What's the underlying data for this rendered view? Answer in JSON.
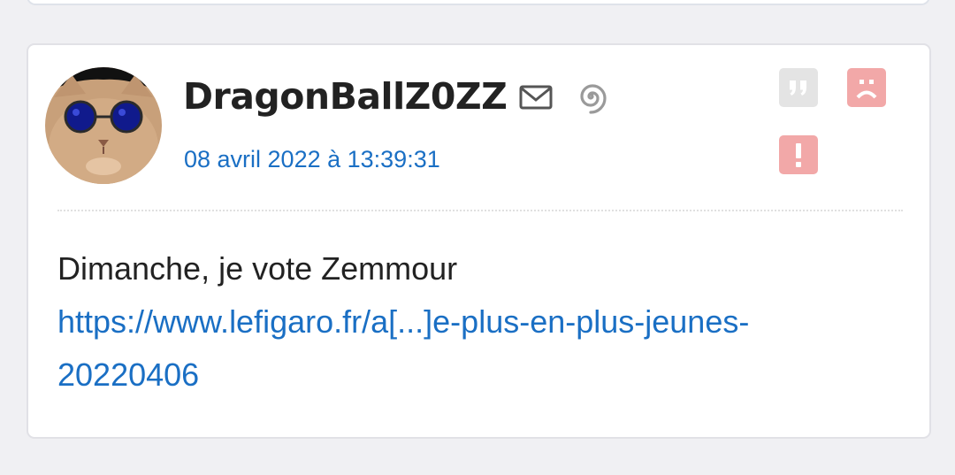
{
  "post": {
    "username": "DragonBallZ0ZZ",
    "date": "08 avril 2022 à 13:39:31",
    "message_text": "Dimanche, je vote Zemmour",
    "link_line1": "https://www.lefigaro.fr/a[...]e-plus-en-plus-jeunes-",
    "link_line2": "20220406"
  },
  "icons": {
    "avatar": "cat-with-blue-sunglasses-avatar",
    "mail": "mail-icon",
    "spiral": "spiral-icon",
    "quote": "quote-icon",
    "sad": "sad-face-icon",
    "report": "exclamation-icon"
  },
  "colors": {
    "background": "#f0f0f3",
    "card": "#ffffff",
    "username": "#222222",
    "link": "#1a6fc4",
    "quote_button": "#e4e4e4",
    "alert_button": "#f2a8a8"
  }
}
